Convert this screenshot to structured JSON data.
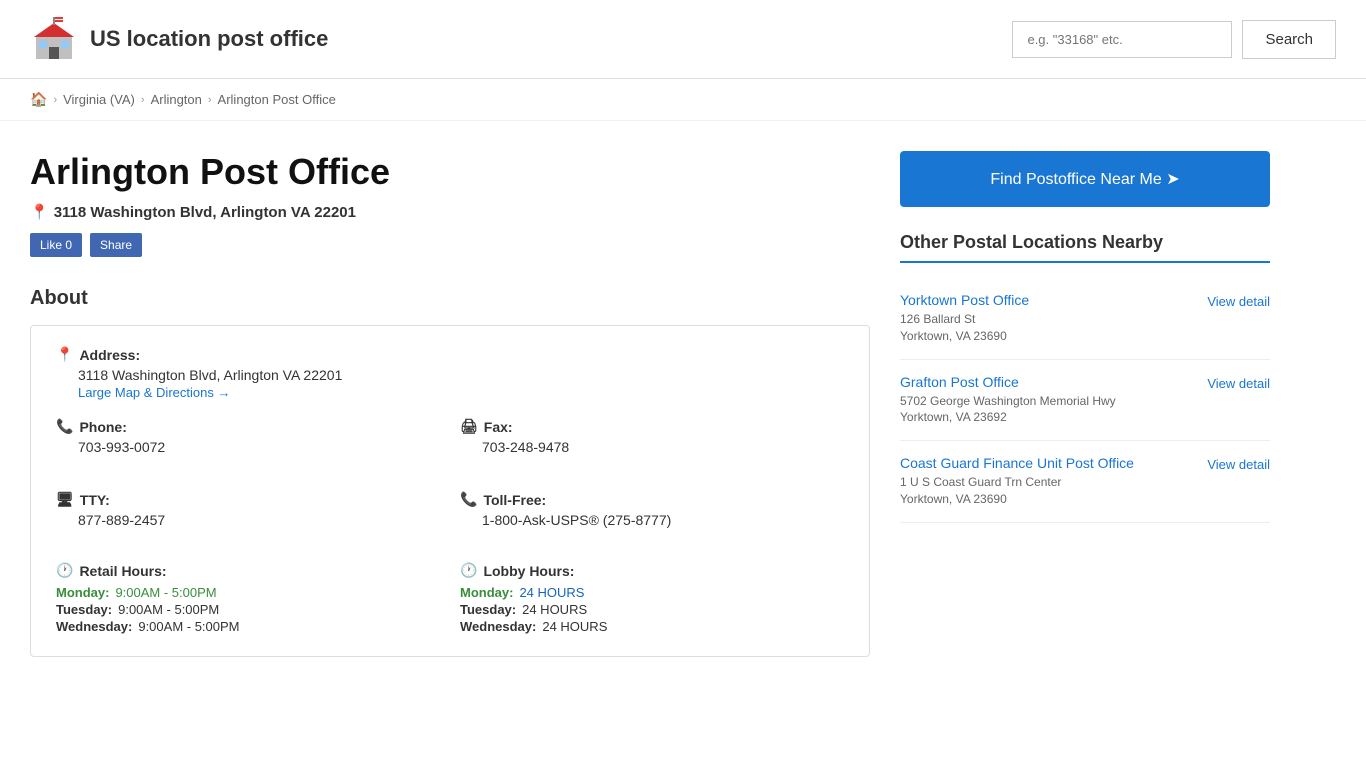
{
  "header": {
    "site_title": "US location post office",
    "search_placeholder": "e.g. \"33168\" etc.",
    "search_label": "Search"
  },
  "breadcrumb": {
    "home_label": "🏠",
    "sep1": ">",
    "crumb1": "Virginia (VA)",
    "sep2": ">",
    "crumb2": "Arlington",
    "sep3": ">",
    "crumb3": "Arlington Post Office"
  },
  "page": {
    "title": "Arlington Post Office",
    "address": "3118 Washington Blvd, Arlington VA 22201",
    "address_full": "3118 Washington Blvd, Arlington VA 22201",
    "directions_label": "Large Map & Directions →",
    "fb_like": "Like 0",
    "fb_share": "Share"
  },
  "about": {
    "heading": "About",
    "address_label": "Address:",
    "phone_label": "Phone:",
    "phone_value": "703-993-0072",
    "fax_label": "Fax:",
    "fax_value": "703-248-9478",
    "tty_label": "TTY:",
    "tty_value": "877-889-2457",
    "tollfree_label": "Toll-Free:",
    "tollfree_value": "1-800-Ask-USPS® (275-8777)",
    "retail_hours_label": "Retail Hours:",
    "lobby_hours_label": "Lobby Hours:",
    "retail_hours": [
      {
        "day": "Monday:",
        "hours": "9:00AM - 5:00PM",
        "highlight": true
      },
      {
        "day": "Tuesday:",
        "hours": "9:00AM - 5:00PM",
        "highlight": false
      },
      {
        "day": "Wednesday:",
        "hours": "9:00AM - 5:00PM",
        "highlight": false
      }
    ],
    "lobby_hours": [
      {
        "day": "Monday:",
        "hours": "24 HOURS",
        "highlight": true
      },
      {
        "day": "Tuesday:",
        "hours": "24 HOURS",
        "highlight": false
      },
      {
        "day": "Wednesday:",
        "hours": "24 HOURS",
        "highlight": false
      }
    ]
  },
  "sidebar": {
    "find_btn_label": "Find Postoffice Near Me ➤",
    "nearby_heading": "Other Postal Locations Nearby",
    "nearby_items": [
      {
        "name": "Yorktown Post Office",
        "address_line1": "126 Ballard St",
        "address_line2": "Yorktown, VA 23690",
        "view_label": "View detail"
      },
      {
        "name": "Grafton Post Office",
        "address_line1": "5702 George Washington Memorial Hwy",
        "address_line2": "Yorktown, VA 23692",
        "view_label": "View detail"
      },
      {
        "name": "Coast Guard Finance Unit Post Office",
        "address_line1": "1 U S Coast Guard Trn Center",
        "address_line2": "Yorktown, VA 23690",
        "view_label": "View detail"
      }
    ]
  }
}
